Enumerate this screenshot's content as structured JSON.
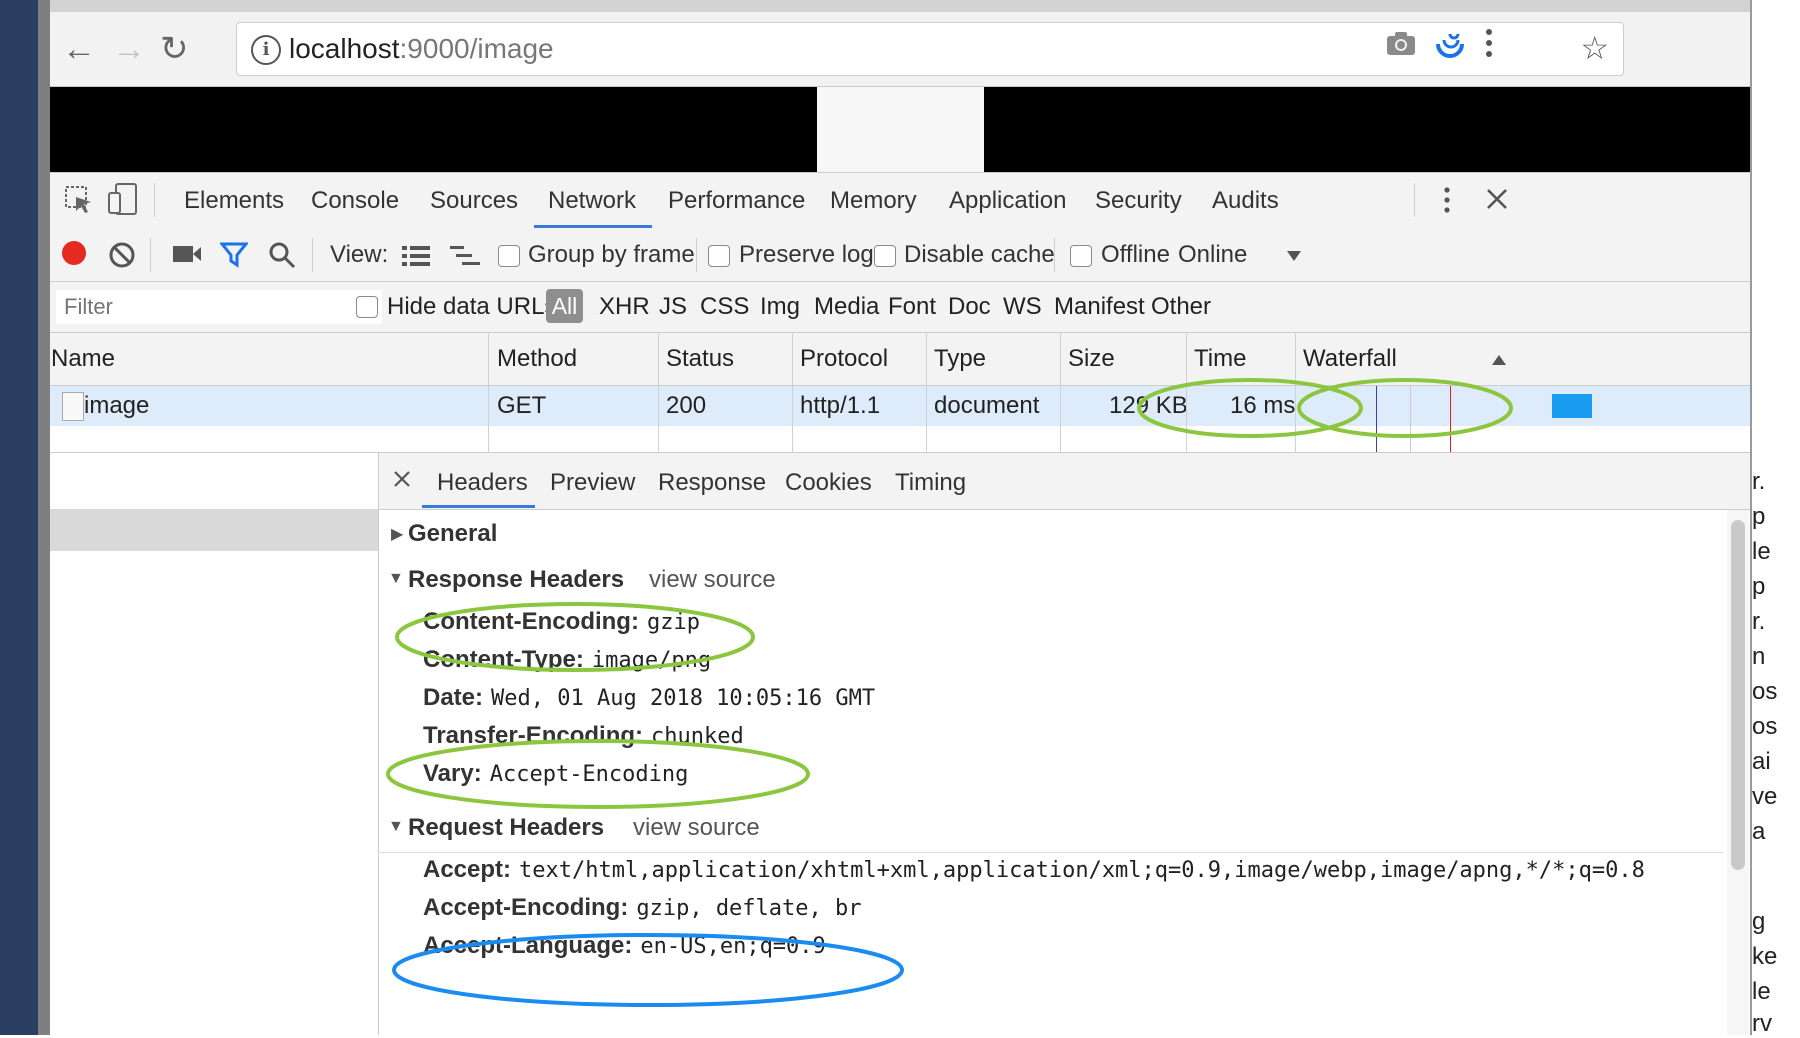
{
  "browser": {
    "url_host": "localhost",
    "url_rest": ":9000/image"
  },
  "devtools": {
    "tabs": [
      "Elements",
      "Console",
      "Sources",
      "Network",
      "Performance",
      "Memory",
      "Application",
      "Security",
      "Audits"
    ],
    "active_tab": "Network"
  },
  "network_toolbar": {
    "view_label": "View:",
    "group_by_frame": "Group by frame",
    "preserve_log": "Preserve log",
    "disable_cache": "Disable cache",
    "offline": "Offline",
    "throttle": "Online"
  },
  "filter_bar": {
    "placeholder": "Filter",
    "hide_data_urls": "Hide data URLs",
    "types": [
      "All",
      "XHR",
      "JS",
      "CSS",
      "Img",
      "Media",
      "Font",
      "Doc",
      "WS",
      "Manifest",
      "Other"
    ]
  },
  "table": {
    "columns": [
      "Name",
      "Method",
      "Status",
      "Protocol",
      "Type",
      "Size",
      "Time",
      "Waterfall"
    ],
    "rows": [
      {
        "name": "image",
        "method": "GET",
        "status": "200",
        "protocol": "http/1.1",
        "type": "document",
        "size": "129 KB",
        "time": "16 ms"
      }
    ]
  },
  "detail": {
    "tabs": [
      "Headers",
      "Preview",
      "Response",
      "Cookies",
      "Timing"
    ],
    "active_tab": "Headers",
    "general_title": "General",
    "response_title": "Response Headers",
    "request_title": "Request Headers",
    "view_source": "view source",
    "response_headers": [
      {
        "key": "Content-Encoding:",
        "value": "gzip"
      },
      {
        "key": "Content-Type:",
        "value": "image/png"
      },
      {
        "key": "Date:",
        "value": "Wed, 01 Aug 2018 10:05:16 GMT"
      },
      {
        "key": "Transfer-Encoding:",
        "value": "chunked"
      },
      {
        "key": "Vary:",
        "value": "Accept-Encoding"
      }
    ],
    "request_headers": [
      {
        "key": "Accept:",
        "value": "text/html,application/xhtml+xml,application/xml;q=0.9,image/webp,image/apng,*/*;q=0.8"
      },
      {
        "key": "Accept-Encoding:",
        "value": "gzip, deflate, br"
      },
      {
        "key": "Accept-Language:",
        "value": "en-US,en;q=0.9"
      }
    ]
  },
  "colors": {
    "highlight_green": "#8cc63f",
    "highlight_blue": "#1a8cf0",
    "selected_row": "#deebfa",
    "accent": "#3879d9"
  },
  "clipped_right_text": [
    "r.",
    "p",
    "le",
    "p",
    "r.",
    "n",
    "os",
    "os",
    "ai",
    "ve",
    "a",
    "g",
    "ke",
    "le",
    "rv"
  ]
}
